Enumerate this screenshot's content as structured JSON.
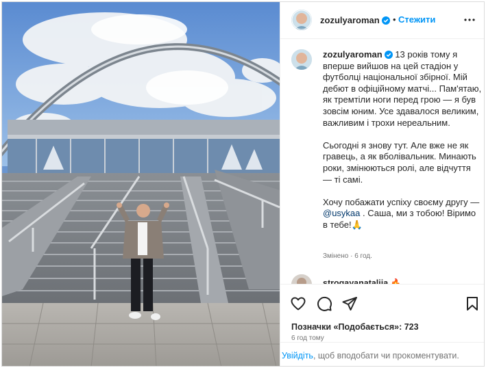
{
  "post": {
    "username": "zozulyaroman",
    "dot": "•",
    "follow_label": "Стежити",
    "more_icon": "more-horizontal-icon"
  },
  "caption": {
    "username": "zozulyaroman",
    "para1": "13 років тому я вперше вийшов на цей стадіон у футболці національної збірної. Мій дебют в офіційному матчі... Пам'ятаю, як тремтіли ноги перед грою — я був зовсім юним. Усе здавалося великим, важливим і трохи нереальним.",
    "para2": "Сьогодні я знову тут. Але вже не як гравець, а як вболівальник. Минають роки, змінюються ролі, але відчуття — ті самі.",
    "para3_start": "Хочу побажати успіху своєму другу — ",
    "mention": "@usykaa",
    "para3_end": " . Саша, ми з тобою! Віримо в тебе!🙏",
    "edited": "Змінено · 6 год."
  },
  "comment": {
    "username": "strogayanataliia",
    "emoji": "🔥"
  },
  "actions": {
    "likes": "Позначки «Подобається»: 723",
    "time": "6 год тому",
    "icons": [
      "heart-icon",
      "comment-icon",
      "share-icon",
      "bookmark-icon"
    ]
  },
  "login": {
    "link": "Увійдіть",
    "text": ", щоб вподобати чи прокоментувати."
  },
  "colors": {
    "accent": "#0095f6",
    "verified": "#0095f6",
    "muted": "#737373",
    "mention": "#00376b"
  }
}
